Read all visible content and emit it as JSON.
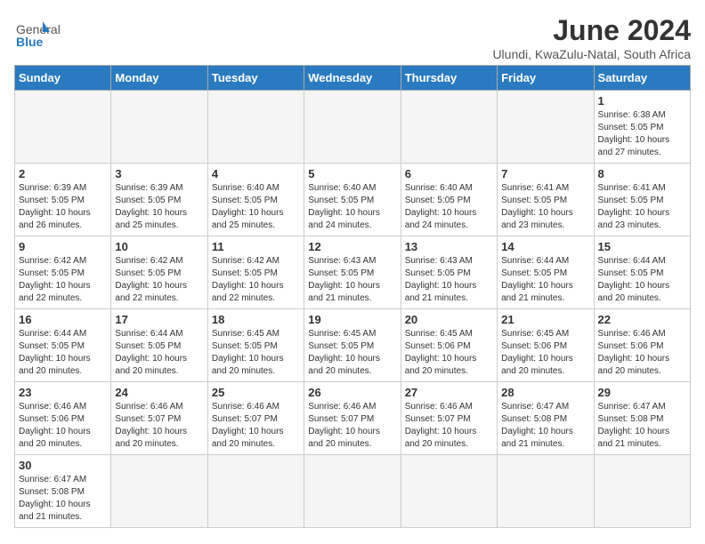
{
  "header": {
    "logo_general": "General",
    "logo_blue": "Blue",
    "title": "June 2024",
    "subtitle": "Ulundi, KwaZulu-Natal, South Africa"
  },
  "days_of_week": [
    "Sunday",
    "Monday",
    "Tuesday",
    "Wednesday",
    "Thursday",
    "Friday",
    "Saturday"
  ],
  "weeks": [
    [
      {
        "day": "",
        "info": ""
      },
      {
        "day": "",
        "info": ""
      },
      {
        "day": "",
        "info": ""
      },
      {
        "day": "",
        "info": ""
      },
      {
        "day": "",
        "info": ""
      },
      {
        "day": "",
        "info": ""
      },
      {
        "day": "1",
        "info": "Sunrise: 6:38 AM\nSunset: 5:05 PM\nDaylight: 10 hours and 27 minutes."
      }
    ],
    [
      {
        "day": "2",
        "info": "Sunrise: 6:39 AM\nSunset: 5:05 PM\nDaylight: 10 hours and 26 minutes."
      },
      {
        "day": "3",
        "info": "Sunrise: 6:39 AM\nSunset: 5:05 PM\nDaylight: 10 hours and 25 minutes."
      },
      {
        "day": "4",
        "info": "Sunrise: 6:40 AM\nSunset: 5:05 PM\nDaylight: 10 hours and 25 minutes."
      },
      {
        "day": "5",
        "info": "Sunrise: 6:40 AM\nSunset: 5:05 PM\nDaylight: 10 hours and 24 minutes."
      },
      {
        "day": "6",
        "info": "Sunrise: 6:40 AM\nSunset: 5:05 PM\nDaylight: 10 hours and 24 minutes."
      },
      {
        "day": "7",
        "info": "Sunrise: 6:41 AM\nSunset: 5:05 PM\nDaylight: 10 hours and 23 minutes."
      },
      {
        "day": "8",
        "info": "Sunrise: 6:41 AM\nSunset: 5:05 PM\nDaylight: 10 hours and 23 minutes."
      }
    ],
    [
      {
        "day": "9",
        "info": "Sunrise: 6:42 AM\nSunset: 5:05 PM\nDaylight: 10 hours and 22 minutes."
      },
      {
        "day": "10",
        "info": "Sunrise: 6:42 AM\nSunset: 5:05 PM\nDaylight: 10 hours and 22 minutes."
      },
      {
        "day": "11",
        "info": "Sunrise: 6:42 AM\nSunset: 5:05 PM\nDaylight: 10 hours and 22 minutes."
      },
      {
        "day": "12",
        "info": "Sunrise: 6:43 AM\nSunset: 5:05 PM\nDaylight: 10 hours and 21 minutes."
      },
      {
        "day": "13",
        "info": "Sunrise: 6:43 AM\nSunset: 5:05 PM\nDaylight: 10 hours and 21 minutes."
      },
      {
        "day": "14",
        "info": "Sunrise: 6:44 AM\nSunset: 5:05 PM\nDaylight: 10 hours and 21 minutes."
      },
      {
        "day": "15",
        "info": "Sunrise: 6:44 AM\nSunset: 5:05 PM\nDaylight: 10 hours and 20 minutes."
      }
    ],
    [
      {
        "day": "16",
        "info": "Sunrise: 6:44 AM\nSunset: 5:05 PM\nDaylight: 10 hours and 20 minutes."
      },
      {
        "day": "17",
        "info": "Sunrise: 6:44 AM\nSunset: 5:05 PM\nDaylight: 10 hours and 20 minutes."
      },
      {
        "day": "18",
        "info": "Sunrise: 6:45 AM\nSunset: 5:05 PM\nDaylight: 10 hours and 20 minutes."
      },
      {
        "day": "19",
        "info": "Sunrise: 6:45 AM\nSunset: 5:05 PM\nDaylight: 10 hours and 20 minutes."
      },
      {
        "day": "20",
        "info": "Sunrise: 6:45 AM\nSunset: 5:06 PM\nDaylight: 10 hours and 20 minutes."
      },
      {
        "day": "21",
        "info": "Sunrise: 6:45 AM\nSunset: 5:06 PM\nDaylight: 10 hours and 20 minutes."
      },
      {
        "day": "22",
        "info": "Sunrise: 6:46 AM\nSunset: 5:06 PM\nDaylight: 10 hours and 20 minutes."
      }
    ],
    [
      {
        "day": "23",
        "info": "Sunrise: 6:46 AM\nSunset: 5:06 PM\nDaylight: 10 hours and 20 minutes."
      },
      {
        "day": "24",
        "info": "Sunrise: 6:46 AM\nSunset: 5:07 PM\nDaylight: 10 hours and 20 minutes."
      },
      {
        "day": "25",
        "info": "Sunrise: 6:46 AM\nSunset: 5:07 PM\nDaylight: 10 hours and 20 minutes."
      },
      {
        "day": "26",
        "info": "Sunrise: 6:46 AM\nSunset: 5:07 PM\nDaylight: 10 hours and 20 minutes."
      },
      {
        "day": "27",
        "info": "Sunrise: 6:46 AM\nSunset: 5:07 PM\nDaylight: 10 hours and 20 minutes."
      },
      {
        "day": "28",
        "info": "Sunrise: 6:47 AM\nSunset: 5:08 PM\nDaylight: 10 hours and 21 minutes."
      },
      {
        "day": "29",
        "info": "Sunrise: 6:47 AM\nSunset: 5:08 PM\nDaylight: 10 hours and 21 minutes."
      }
    ],
    [
      {
        "day": "30",
        "info": "Sunrise: 6:47 AM\nSunset: 5:08 PM\nDaylight: 10 hours and 21 minutes."
      },
      {
        "day": "",
        "info": ""
      },
      {
        "day": "",
        "info": ""
      },
      {
        "day": "",
        "info": ""
      },
      {
        "day": "",
        "info": ""
      },
      {
        "day": "",
        "info": ""
      },
      {
        "day": "",
        "info": ""
      }
    ]
  ]
}
